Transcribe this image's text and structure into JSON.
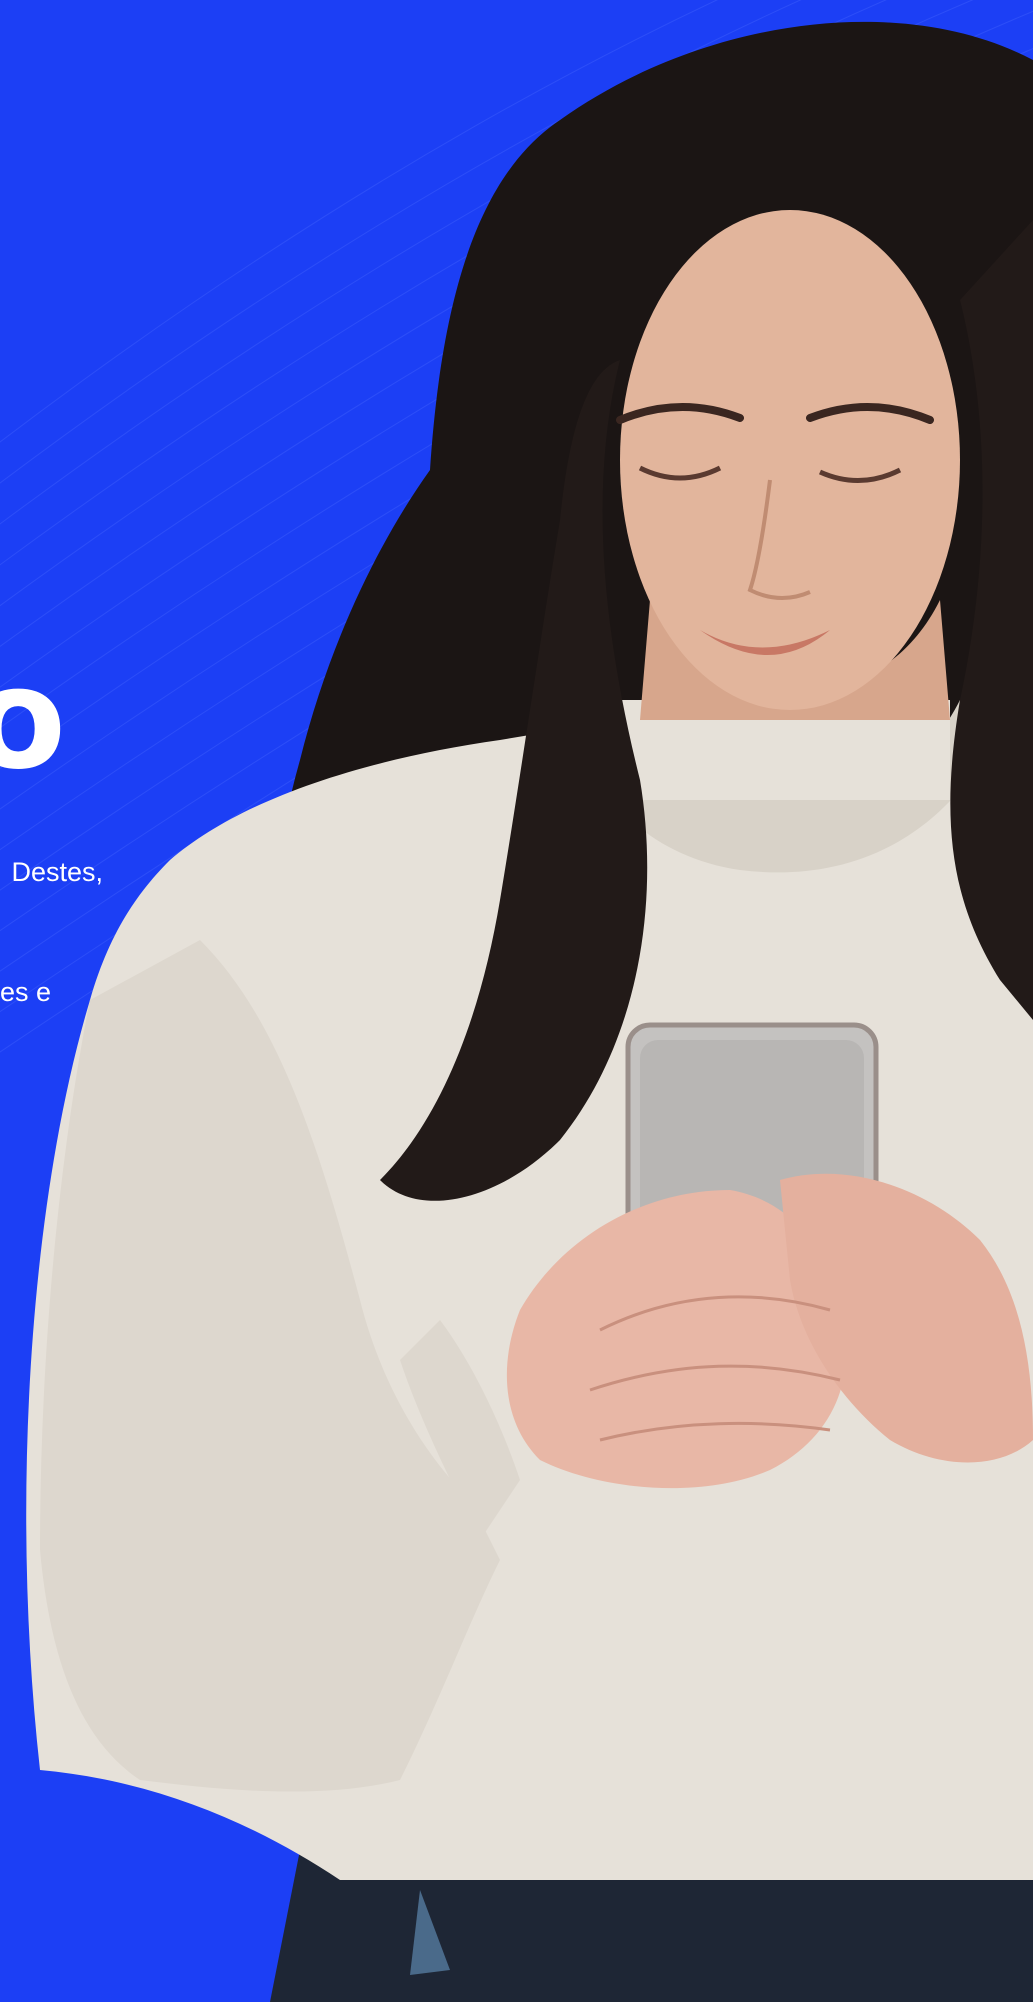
{
  "hero": {
    "headline_fragment": "o",
    "description_lines": [
      "Destes,",
      "es e"
    ]
  },
  "colors": {
    "background": "#1c3ff5",
    "text": "#ffffff",
    "sweater": "#e6e1d9",
    "hair": "#1b1514",
    "skin": "#e2b59c",
    "phone": "#c4c2c0"
  },
  "image": {
    "subject": "woman-smiling-looking-at-smartphone"
  }
}
